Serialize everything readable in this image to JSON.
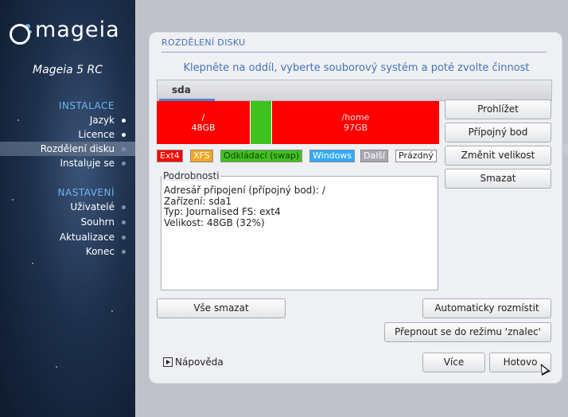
{
  "brand": {
    "logo_text": "mageia",
    "product": "Mageia 5 RC"
  },
  "sidebar": {
    "install_heading": "INSTALACE",
    "install_steps": [
      {
        "label": "Jazyk"
      },
      {
        "label": "Licence"
      },
      {
        "label": "Rozdělení disku"
      },
      {
        "label": "Instaluje se"
      }
    ],
    "settings_heading": "NASTAVENÍ",
    "settings_steps": [
      {
        "label": "Uživatelé"
      },
      {
        "label": "Souhrn"
      },
      {
        "label": "Aktualizace"
      },
      {
        "label": "Konec"
      }
    ],
    "active_step": "Rozdělení disku"
  },
  "panel": {
    "title": "ROZDĚLENÍ DISKU",
    "instruction": "Klepněte na oddíl, vyberte souborový systém a poté zvolte činnost",
    "disk_tab": "sda",
    "partitions": [
      {
        "name": "/",
        "size": "48GB",
        "color": "#ff0000"
      },
      {
        "name": "",
        "size": "",
        "color": "#3fc21f"
      },
      {
        "name": "/home",
        "size": "97GB",
        "color": "#ff0000"
      }
    ],
    "legend": [
      {
        "label": "Ext4",
        "bg": "#ff0000",
        "fg": "#ffffff"
      },
      {
        "label": "XFS",
        "bg": "#f5a623",
        "fg": "#ffffff"
      },
      {
        "label": "Odkládací (swap)",
        "bg": "#3fc21f",
        "fg": "#1a3a10"
      },
      {
        "label": "Windows",
        "bg": "#33aaff",
        "fg": "#ffffff"
      },
      {
        "label": "Další",
        "bg": "#a9a9b3",
        "fg": "#ffffff"
      },
      {
        "label": "Prázdný",
        "bg": "#ffffff",
        "fg": "#222222"
      }
    ],
    "actions": {
      "view": "Prohlížet",
      "mount_point": "Přípojný bod",
      "resize": "Změnit velikost",
      "delete": "Smazat"
    },
    "details": {
      "legend": "Podrobnosti",
      "lines": [
        "Adresář připojení (přípojný bod): /",
        "Zařízení: sda1",
        "Typ: Journalised FS: ext4",
        "Velikost: 48GB (32%)"
      ]
    },
    "buttons": {
      "clear_all": "Vše smazat",
      "auto_allocate": "Automaticky rozmístit",
      "expert_mode": "Přepnout se do režimu 'znalec'",
      "help": "Nápověda",
      "more": "Více",
      "done": "Hotovo"
    }
  }
}
